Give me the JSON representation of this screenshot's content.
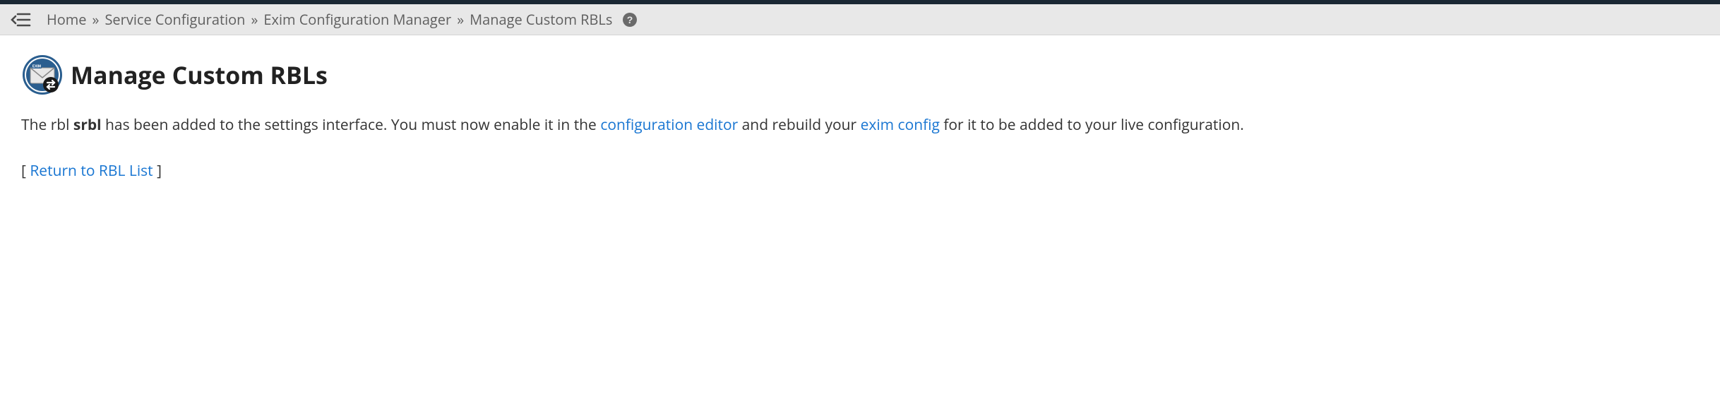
{
  "breadcrumb": {
    "items": [
      {
        "label": "Home"
      },
      {
        "label": "Service Configuration"
      },
      {
        "label": "Exim Configuration Manager"
      },
      {
        "label": "Manage Custom RBLs"
      }
    ],
    "separator": "»"
  },
  "page": {
    "title": "Manage Custom RBLs",
    "icon_name": "exim-mail-icon"
  },
  "message": {
    "text_1": "The rbl ",
    "rbl_name": "srbl",
    "text_2": " has been added to the settings interface. You must now enable it in the ",
    "link_1": "configuration editor",
    "text_3": " and rebuild your ",
    "link_2": "exim config",
    "text_4": " for it to be added to your live configuration."
  },
  "return": {
    "bracket_open": "[ ",
    "label": "Return to RBL List",
    "bracket_close": " ]"
  }
}
